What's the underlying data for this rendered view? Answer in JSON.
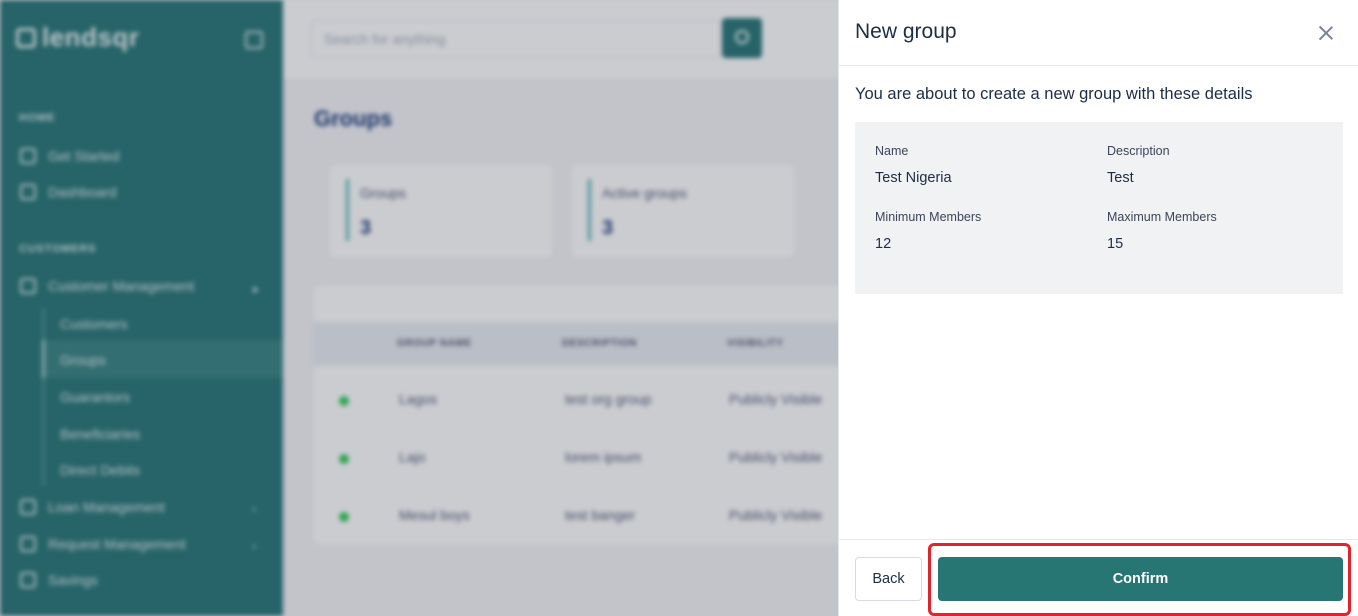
{
  "sidebar": {
    "logo": "lendsqr",
    "sections": {
      "home": "HOME",
      "customers": "CUSTOMERS"
    },
    "items": [
      {
        "label": "Get Started"
      },
      {
        "label": "Dashboard"
      },
      {
        "label": "Customer Management"
      },
      {
        "label": "Loan Management"
      },
      {
        "label": "Request Management"
      },
      {
        "label": "Savings"
      }
    ],
    "sub_items": [
      {
        "label": "Customers"
      },
      {
        "label": "Groups"
      },
      {
        "label": "Guarantors"
      },
      {
        "label": "Beneficiaries"
      },
      {
        "label": "Direct Debits"
      }
    ]
  },
  "search": {
    "placeholder": "Search for anything"
  },
  "page": {
    "title": "Groups",
    "stats": [
      {
        "label": "Groups",
        "value": "3"
      },
      {
        "label": "Active groups",
        "value": "3"
      }
    ],
    "table": {
      "headers": [
        "GROUP NAME",
        "DESCRIPTION",
        "VISIBILITY"
      ],
      "rows": [
        {
          "name": "Lagos",
          "description": "test org group",
          "visibility": "Publicly Visible"
        },
        {
          "name": "Lajo",
          "description": "lorem ipsum",
          "visibility": "Publicly Visible"
        },
        {
          "name": "Mesul boys",
          "description": "test banger",
          "visibility": "Publicly Visible"
        }
      ]
    }
  },
  "drawer": {
    "title": "New group",
    "intro": "You are about to create a new group with these details",
    "details": {
      "name_label": "Name",
      "name_value": "Test Nigeria",
      "description_label": "Description",
      "description_value": "Test",
      "min_label": "Minimum Members",
      "min_value": "12",
      "max_label": "Maximum Members",
      "max_value": "15"
    },
    "back_label": "Back",
    "confirm_label": "Confirm"
  },
  "colors": {
    "brand": "#277674",
    "highlight": "#e0242b",
    "status_active": "#39cd62"
  }
}
